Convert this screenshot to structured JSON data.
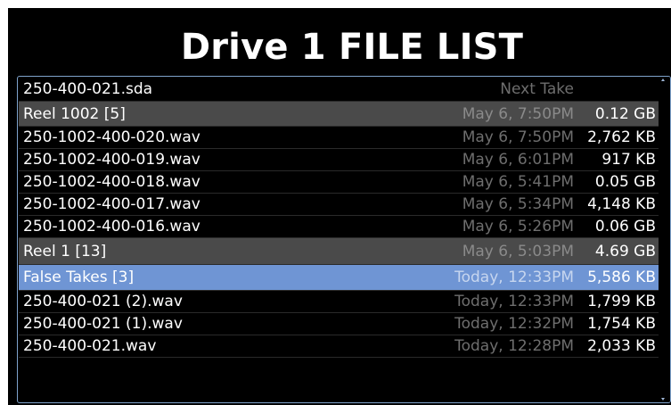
{
  "title": "Drive 1 FILE LIST",
  "rows": [
    {
      "name": "250-400-021.sda",
      "date": "Next Take",
      "size": "",
      "type": "file"
    },
    {
      "name": "Reel 1002 [5]",
      "date": "May 6, 7:50PM",
      "size": "0.12 GB",
      "type": "folder"
    },
    {
      "name": "250-1002-400-020.wav",
      "date": "May 6, 7:50PM",
      "size": "2,762 KB",
      "type": "file"
    },
    {
      "name": "250-1002-400-019.wav",
      "date": "May 6, 6:01PM",
      "size": "917 KB",
      "type": "file"
    },
    {
      "name": "250-1002-400-018.wav",
      "date": "May 6, 5:41PM",
      "size": "0.05 GB",
      "type": "file"
    },
    {
      "name": "250-1002-400-017.wav",
      "date": "May 6, 5:34PM",
      "size": "4,148 KB",
      "type": "file"
    },
    {
      "name": "250-1002-400-016.wav",
      "date": "May 6, 5:26PM",
      "size": "0.06 GB",
      "type": "file"
    },
    {
      "name": "Reel 1 [13]",
      "date": "May 6, 5:03PM",
      "size": "4.69 GB",
      "type": "folder"
    },
    {
      "name": "False Takes [3]",
      "date": "Today, 12:33PM",
      "size": "5,586 KB",
      "type": "selected"
    },
    {
      "name": "250-400-021 (2).wav",
      "date": "Today, 12:33PM",
      "size": "1,799 KB",
      "type": "file"
    },
    {
      "name": "250-400-021 (1).wav",
      "date": "Today, 12:32PM",
      "size": "1,754 KB",
      "type": "file"
    },
    {
      "name": "250-400-021.wav",
      "date": "Today, 12:28PM",
      "size": "2,033 KB",
      "type": "file"
    }
  ],
  "colors": {
    "background": "#000000",
    "folder_row": "#4a4a4a",
    "selected_row": "#6f95d4",
    "panel_border": "#7fa3cc",
    "date_text": "#6e6e6e"
  }
}
